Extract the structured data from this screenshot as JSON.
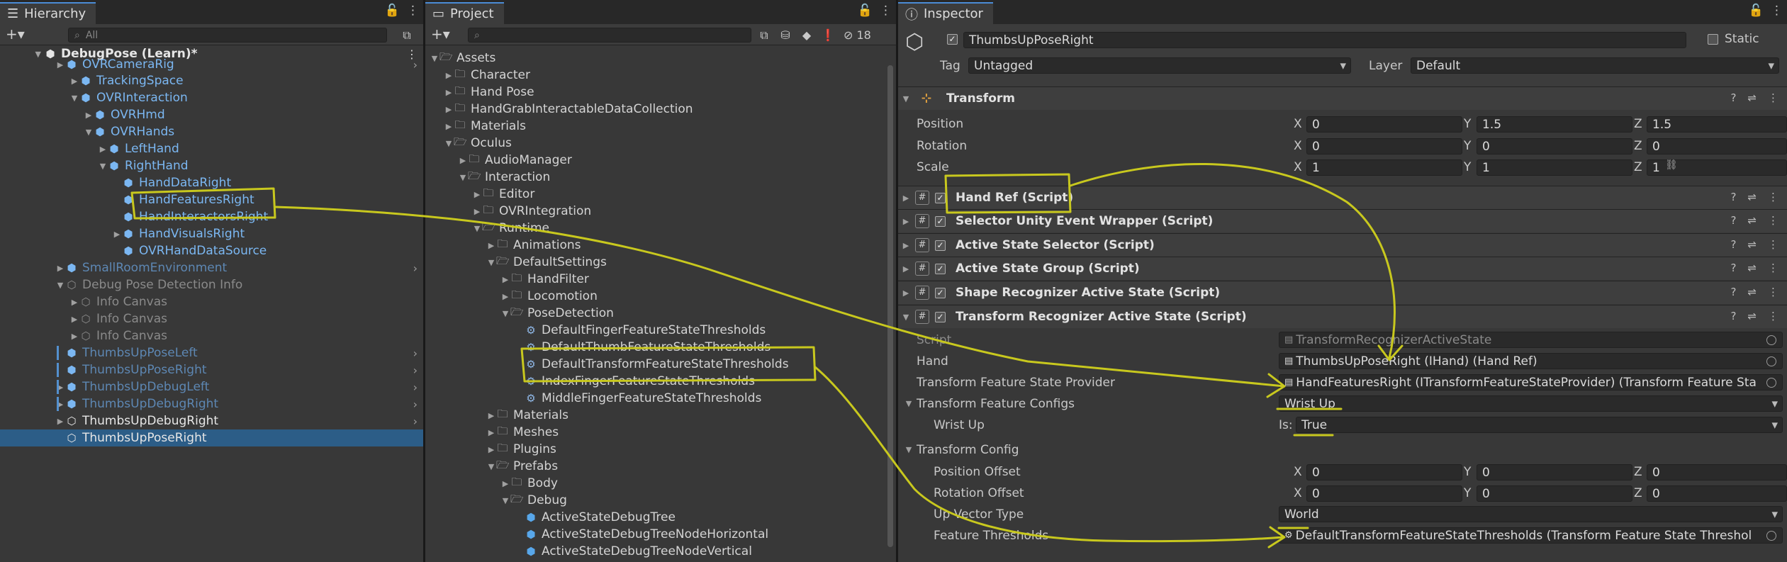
{
  "hierarchy": {
    "tab_label": "Hierarchy",
    "search_placeholder": "All",
    "scene_root": "DebugPose (Learn)*",
    "items": [
      {
        "label": "OVRCameraRig",
        "style": "blue"
      },
      {
        "label": "TrackingSpace",
        "style": "blue"
      },
      {
        "label": "OVRInteraction",
        "style": "blue"
      },
      {
        "label": "OVRHmd",
        "style": "blue"
      },
      {
        "label": "OVRHands",
        "style": "blue"
      },
      {
        "label": "LeftHand",
        "style": "blue"
      },
      {
        "label": "RightHand",
        "style": "blue"
      },
      {
        "label": "HandDataRight",
        "style": "blue"
      },
      {
        "label": "HandFeaturesRight",
        "style": "blue"
      },
      {
        "label": "HandInteractorsRight",
        "style": "blue"
      },
      {
        "label": "HandVisualsRight",
        "style": "blue"
      },
      {
        "label": "OVRHandDataSource",
        "style": "blue"
      },
      {
        "label": "SmallRoomEnvironment",
        "style": "dimblue"
      },
      {
        "label": "Debug Pose Detection Info",
        "style": "dim"
      },
      {
        "label": "Info Canvas",
        "style": "dim"
      },
      {
        "label": "Info Canvas",
        "style": "dim"
      },
      {
        "label": "Info Canvas",
        "style": "dim"
      },
      {
        "label": "ThumbsUpPoseLeft",
        "style": "dimblue"
      },
      {
        "label": "ThumbsUpPoseRight",
        "style": "dimblue"
      },
      {
        "label": "ThumbsUpDebugLeft",
        "style": "dimblue"
      },
      {
        "label": "ThumbsUpDebugRight",
        "style": "dimblue"
      },
      {
        "label": "ThumbsUpDebugRight",
        "style": "wh"
      },
      {
        "label": "ThumbsUpPoseRight",
        "style": "wh"
      }
    ]
  },
  "project": {
    "tab_label": "Project",
    "hidden_count": "18",
    "items": [
      {
        "label": "Assets",
        "kind": "folder"
      },
      {
        "label": "Character",
        "kind": "folder"
      },
      {
        "label": "Hand Pose",
        "kind": "folder"
      },
      {
        "label": "HandGrabInteractableDataCollection",
        "kind": "folder"
      },
      {
        "label": "Materials",
        "kind": "folder"
      },
      {
        "label": "Oculus",
        "kind": "folder"
      },
      {
        "label": "AudioManager",
        "kind": "folder"
      },
      {
        "label": "Interaction",
        "kind": "folder"
      },
      {
        "label": "Editor",
        "kind": "folder"
      },
      {
        "label": "OVRIntegration",
        "kind": "folder"
      },
      {
        "label": "Runtime",
        "kind": "folder"
      },
      {
        "label": "Animations",
        "kind": "folder"
      },
      {
        "label": "DefaultSettings",
        "kind": "folder"
      },
      {
        "label": "HandFilter",
        "kind": "folder"
      },
      {
        "label": "Locomotion",
        "kind": "folder"
      },
      {
        "label": "PoseDetection",
        "kind": "folder"
      },
      {
        "label": "DefaultFingerFeatureStateThresholds",
        "kind": "asset"
      },
      {
        "label": "DefaultThumbFeatureStateThresholds",
        "kind": "asset"
      },
      {
        "label": "DefaultTransformFeatureStateThresholds",
        "kind": "asset"
      },
      {
        "label": "IndexFingerFeatureStateThresholds",
        "kind": "asset"
      },
      {
        "label": "MiddleFingerFeatureStateThresholds",
        "kind": "asset"
      },
      {
        "label": "Materials",
        "kind": "folder"
      },
      {
        "label": "Meshes",
        "kind": "folder"
      },
      {
        "label": "Plugins",
        "kind": "folder"
      },
      {
        "label": "Prefabs",
        "kind": "folder"
      },
      {
        "label": "Body",
        "kind": "folder"
      },
      {
        "label": "Debug",
        "kind": "folder"
      },
      {
        "label": "ActiveStateDebugTree",
        "kind": "prefab"
      },
      {
        "label": "ActiveStateDebugTreeNodeHorizontal",
        "kind": "prefab"
      },
      {
        "label": "ActiveStateDebugTreeNodeVertical",
        "kind": "prefab"
      }
    ]
  },
  "inspector": {
    "tab_label": "Inspector",
    "object_name": "ThumbsUpPoseRight",
    "static_label": "Static",
    "tag_label": "Tag",
    "tag_value": "Untagged",
    "layer_label": "Layer",
    "layer_value": "Default",
    "transform": {
      "title": "Transform",
      "position_label": "Position",
      "rotation_label": "Rotation",
      "scale_label": "Scale",
      "position": [
        "0",
        "1.5",
        "1.5"
      ],
      "rotation": [
        "0",
        "0",
        "0"
      ],
      "scale": [
        "1",
        "1",
        "1"
      ]
    },
    "axis": [
      "X",
      "Y",
      "Z"
    ],
    "components": [
      "Hand Ref (Script)",
      "Selector Unity Event Wrapper (Script)",
      "Active State Selector (Script)",
      "Active State Group (Script)",
      "Shape Recognizer Active State (Script)",
      "Transform Recognizer Active State (Script)"
    ],
    "tras": {
      "script_label": "Script",
      "script_value": "TransformRecognizerActiveState",
      "hand_label": "Hand",
      "hand_value": "ThumbsUpPoseRight (IHand) (Hand Ref)",
      "provider_label": "Transform Feature State Provider",
      "provider_value": "HandFeaturesRight (ITransformFeatureStateProvider) (Transform Feature Sta",
      "configs_label": "Transform Feature Configs",
      "configs_value": "Wrist Up",
      "wrist_label": "Wrist Up",
      "is_label": "Is:",
      "is_value": "True",
      "config_label": "Transform Config",
      "pos_offset_label": "Position Offset",
      "pos_offset": [
        "0",
        "0",
        "0"
      ],
      "rot_offset_label": "Rotation Offset",
      "rot_offset": [
        "0",
        "0",
        "0"
      ],
      "up_label": "Up Vector Type",
      "up_value": "World",
      "thresh_label": "Feature Thresholds",
      "thresh_value": "DefaultTransformFeatureStateThresholds (Transform Feature State Threshol"
    }
  },
  "colors": {
    "annotation": "#c8c81e",
    "selection": "#2c5d87",
    "accent": "#4b8cd6"
  }
}
